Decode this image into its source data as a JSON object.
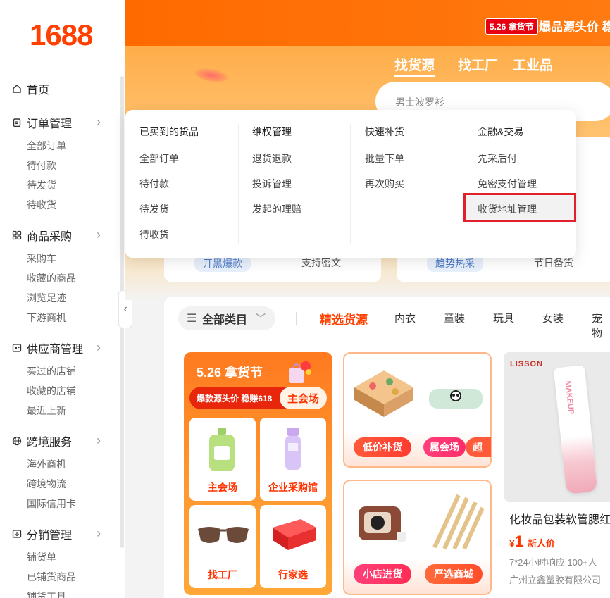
{
  "logo": "1688",
  "sidebar": {
    "sections": [
      {
        "title": "首页",
        "icon": "home-icon",
        "items": []
      },
      {
        "title": "订单管理",
        "icon": "order-icon",
        "items": [
          "全部订单",
          "待付款",
          "待发货",
          "待收货"
        ]
      },
      {
        "title": "商品采购",
        "icon": "grid-icon",
        "items": [
          "采购车",
          "收藏的商品",
          "浏览足迹",
          "下游商机"
        ]
      },
      {
        "title": "供应商管理",
        "icon": "supplier-icon",
        "items": [
          "买过的店铺",
          "收藏的店铺",
          "最近上新"
        ]
      },
      {
        "title": "跨境服务",
        "icon": "globe-icon",
        "items": [
          "海外商机",
          "跨境物流",
          "国际信用卡"
        ]
      },
      {
        "title": "分销管理",
        "icon": "distribution-icon",
        "items": [
          "铺货单",
          "已铺货商品",
          "铺货工具"
        ]
      }
    ]
  },
  "header": {
    "promo_badge": "5.26 拿货节",
    "promo_text": "爆品源头价 稳",
    "tabs": [
      "找货源",
      "找工厂",
      "工业品"
    ],
    "search_placeholder": "男士波罗衫"
  },
  "dropdown": {
    "columns": [
      {
        "title": "已买到的货品",
        "items": [
          "全部订单",
          "待付款",
          "待发货",
          "待收货"
        ]
      },
      {
        "title": "维权管理",
        "items": [
          "退货退款",
          "投诉管理",
          "发起的理赔"
        ]
      },
      {
        "title": "快速补货",
        "items": [
          "批量下单",
          "再次购买"
        ]
      },
      {
        "title": "金融&交易",
        "items": [
          "先采后付",
          "免密支付管理",
          "收货地址管理"
        ]
      }
    ],
    "highlighted_item": "收货地址管理"
  },
  "behind_cards": {
    "left_pill": "开黑爆款",
    "left_text": "支持密文",
    "right_pill": "趋势热采",
    "right_text": "节日备货"
  },
  "categories": {
    "all_label": "全部类目",
    "featured": "精选货源",
    "items": [
      "内衣",
      "童装",
      "玩具",
      "女装",
      "宠物"
    ]
  },
  "festival": {
    "title": "5.26 拿货节",
    "slogan": "爆款源头价 稳赚618",
    "button": "主会场",
    "tiles": [
      "主会场",
      "企业采购馆",
      "找工厂",
      "行家选"
    ]
  },
  "promo_cards": [
    {
      "buttons": [
        "低价补货",
        "属会场",
        "超"
      ]
    },
    {
      "buttons": [
        "小店进货",
        "严选商城"
      ]
    }
  ],
  "product": {
    "brand": "LISSON",
    "tube_text": "MAKEUP",
    "title": "化妆品包装软管腮红",
    "price_symbol": "¥",
    "price": "1",
    "price_tag": "新人价",
    "service": "7*24小时响应  100+人",
    "company": "广州立鑫塑胶有限公司"
  },
  "colors": {
    "brand": "#ff4000",
    "highlight_border": "#e0202a"
  }
}
